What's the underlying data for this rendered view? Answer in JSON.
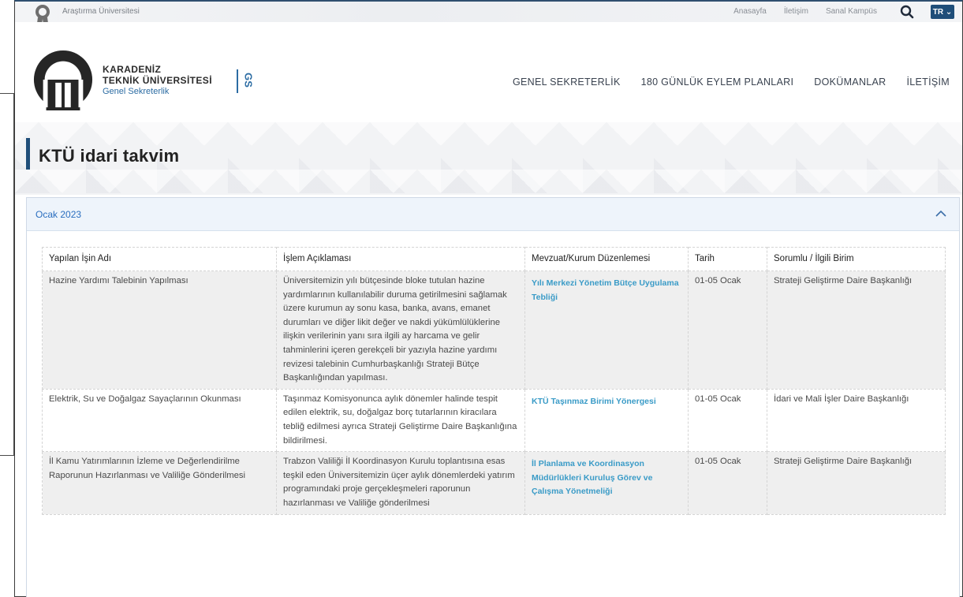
{
  "topbar": {
    "university_tag": "Araştırma Üniversitesi",
    "links": [
      "Anasayfa",
      "İletişim",
      "Sanal Kampüs"
    ],
    "language": "TR ⌄"
  },
  "logo": {
    "line1": "KARADENİZ",
    "line2": "TEKNİK ÜNİVERSİTESİ",
    "line3": "Genel Sekreterlik",
    "badge": "GS"
  },
  "nav": [
    "GENEL SEKRETERLİK",
    "180 GÜNLÜK EYLEM PLANLARI",
    "DOKÜMANLAR",
    "İLETİŞİM"
  ],
  "page_title": "KTÜ idari takvim",
  "panel": {
    "title": "Ocak 2023"
  },
  "table": {
    "headers": [
      "Yapılan İşin Adı",
      "İşlem Açıklaması",
      "Mevzuat/Kurum Düzenlemesi",
      "Tarih",
      "Sorumlu / İlgili Birim"
    ],
    "rows": [
      {
        "name": "Hazine Yardımı Talebinin Yapılması",
        "desc": "Üniversitemizin yılı bütçesinde bloke tutulan hazine yardımlarının kullanılabilir duruma getirilmesini sağlamak üzere kurumun ay sonu kasa, banka, avans, emanet durumları ve diğer likit değer ve nakdi yükümlülüklerine ilişkin verilerinin yanı sıra ilgili ay harcama ve gelir tahminlerini içeren gerekçeli bir yazıyla hazine yardımı revizesi talebinin Cumhurbaşkanlığı Strateji Bütçe Başkanlığından yapılması.",
        "reg": "Yılı Merkezi Yönetim Bütçe Uygulama Tebliği",
        "date": "01-05 Ocak",
        "unit": "Strateji Geliştirme Daire Başkanlığı"
      },
      {
        "name": "Elektrik, Su ve Doğalgaz Sayaçlarının Okunması",
        "desc": "Taşınmaz Komisyonunca aylık dönemler halinde tespit edilen elektrik, su, doğalgaz borç tutarlarının kiracılara tebliğ edilmesi ayrıca Strateji Geliştirme Daire Başkanlığına bildirilmesi.",
        "reg": "KTÜ Taşınmaz Birimi Yönergesi",
        "date": "01-05 Ocak",
        "unit": "İdari ve Mali İşler Daire Başkanlığı"
      },
      {
        "name": "İl Kamu Yatırımlarının İzleme ve Değerlendirilme Raporunun Hazırlanması ve Valiliğe Gönderilmesi",
        "desc": "Trabzon Valiliği İl Koordinasyon Kurulu toplantısına esas teşkil eden Üniversitemizin üçer aylık dönemlerdeki yatırım programındaki proje gerçekleşmeleri raporunun hazırlanması ve Valiliğe gönderilmesi",
        "reg": "İl Planlama ve Koordinasyon Müdürlükleri Kuruluş Görev ve Çalışma Yönetmeliği",
        "date": "01-05 Ocak",
        "unit": "Strateji Geliştirme Daire Başkanlığı"
      }
    ]
  }
}
